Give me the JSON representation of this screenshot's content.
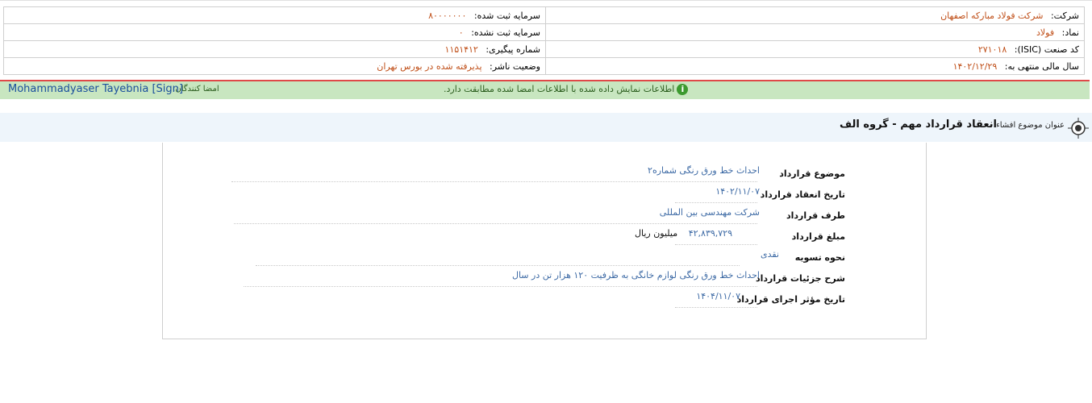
{
  "header": {
    "company_label": "شرکت:",
    "company_value": "شرکت فولاد مبارکه اصفهان",
    "registered_capital_label": "سرمایه ثبت شده:",
    "registered_capital_value": "۸۰۰۰۰۰۰۰",
    "symbol_label": "نماد:",
    "symbol_value": "فولاد",
    "unregistered_capital_label": "سرمایه ثبت نشده:",
    "unregistered_capital_value": "۰",
    "isic_label": "کد صنعت (ISIC):",
    "isic_value": "۲۷۱۰۱۸",
    "tracking_label": "شماره پیگیری:",
    "tracking_value": "۱۱۵۱۴۱۲",
    "fiscal_year_label": "سال مالی منتهی به:",
    "fiscal_year_value": "۱۴۰۲/۱۲/۲۹",
    "publisher_status_label": "وضعیت ناشر:",
    "publisher_status_value": "پذیرفته شده در بورس تهران"
  },
  "signature": {
    "message": "اطلاعات نمایش داده شده با اطلاعات امضا شده مطابقت دارد.",
    "signers_label": "امضا کنندگان:",
    "signers_value": "Mohammadyaser Tayebnia [Sign]",
    "icon": "info-icon",
    "bar_color": "#c8e6c0",
    "accent_color": "#e04848"
  },
  "disclosure": {
    "title_label": "عنوان موضوع افشاء:",
    "title_value": "انعقاد قرارداد مهم - گروه الف"
  },
  "contract": {
    "rows": [
      {
        "label": "موضوع قرارداد",
        "value": "احداث خط ورق رنگی شماره۲"
      },
      {
        "label": "تاریخ انعقاد قرارداد",
        "value": "۱۴۰۲/۱۱/۰۷"
      },
      {
        "label": "طرف قرارداد",
        "value": "شرکت مهندسی بین المللی"
      },
      {
        "label": "مبلغ قرارداد",
        "value": "۴۲,۸۳۹,۷۲۹",
        "unit": "میلیون ریال"
      },
      {
        "label": "نحوه تسویه",
        "value": "نقدی"
      },
      {
        "label": "شرح جزئیات قرارداد",
        "value": "احداث خط ورق رنگی لوازم خانگی به ظرفیت ۱۲۰ هزار تن در سال"
      },
      {
        "label": "تاریخ مؤثر اجرای قرارداد",
        "value": "۱۴۰۴/۱۱/۰۷"
      }
    ]
  }
}
